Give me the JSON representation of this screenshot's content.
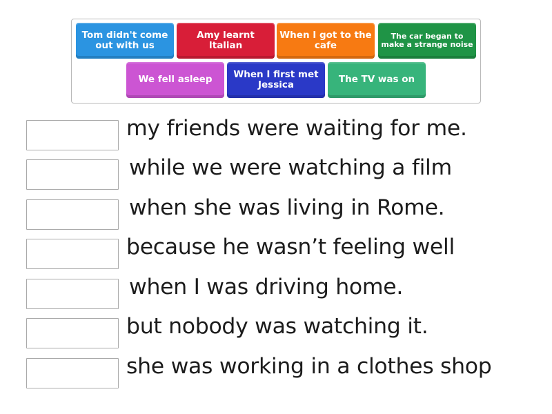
{
  "tiles": [
    {
      "label": "Tom didn't come out with us",
      "color": "#2b94e1"
    },
    {
      "label": "Amy learnt Italian",
      "color": "#d81e38"
    },
    {
      "label": "When I got to the cafe",
      "color": "#f77a12"
    },
    {
      "label": "The car began to make a strange noise",
      "color": "#1f9446"
    },
    {
      "label": "We fell asleep",
      "color": "#cc55d3"
    },
    {
      "label": "When I first met Jessica",
      "color": "#2a39c7"
    },
    {
      "label": "The TV was on",
      "color": "#37b47b"
    }
  ],
  "sentences": [
    {
      "answer": "",
      "text": "my friends were waiting for me."
    },
    {
      "answer": "",
      "text": "while we were watching a film"
    },
    {
      "answer": "",
      "text": "when she was living in Rome."
    },
    {
      "answer": "",
      "text": "because he wasn’t feeling well"
    },
    {
      "answer": "",
      "text": "when I was driving home."
    },
    {
      "answer": "",
      "text": "but nobody was watching it."
    },
    {
      "answer": "",
      "text": "she was working in a clothes shop"
    }
  ]
}
